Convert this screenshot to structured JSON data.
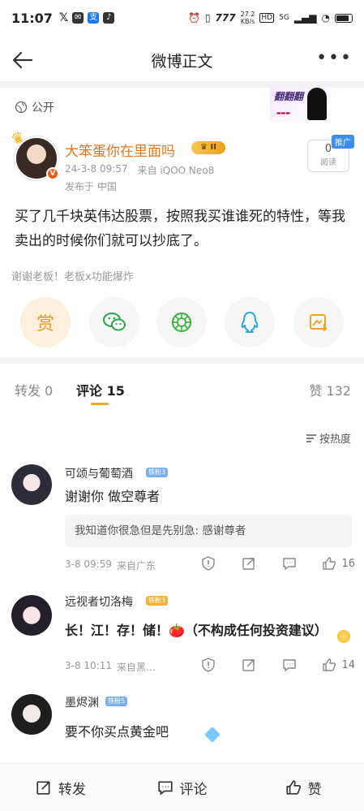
{
  "status_bar": {
    "time": "11:07",
    "net_speed": "27.2",
    "net_unit": "KB/s",
    "hd": "HD",
    "net_type": "5G"
  },
  "nav": {
    "title": "微博正文"
  },
  "post": {
    "visibility": "公开",
    "author_name": "大笨蛋你在里面吗",
    "level": "II",
    "date": "24-3-8 09:57",
    "source": "来自 iQOO Neo8",
    "location": "发布于 中国",
    "read_count": "0",
    "read_label": "阅读",
    "promo_label": "推广",
    "text": "买了几千块英伟达股票，按照我买谁谁死的特性，等我卖出的时候你们就可以抄底了。",
    "tagline": "谢谢老板！老板x功能爆炸",
    "reward_label": "赏"
  },
  "tabs": {
    "repost": "转发 0",
    "comment": "评论 15",
    "like": "赞 132"
  },
  "sort_label": "按热度",
  "comments": [
    {
      "name": "可颂与葡萄酒",
      "badge": "铁粉3",
      "text": "谢谢你 做空尊者",
      "reply": "我知道你很急但是先别急: 感谢尊者",
      "time": "3-8 09:59",
      "source": "来自广东",
      "likes": "16"
    },
    {
      "name": "远视者切洛梅",
      "badge": "铁粉3",
      "text": "长！江！存！储！🍅（不构成任何投资建议）",
      "time": "3-8 10:11",
      "source": "来自黑…",
      "likes": "14"
    },
    {
      "name": "墨烬渊",
      "badge": "铁粉5",
      "text": "要不你买点黄金吧"
    }
  ],
  "bottom_bar": {
    "repost": "转发",
    "comment": "评论",
    "like": "赞"
  },
  "colors": {
    "author_name": "#e4761c",
    "accent": "#f5a623",
    "wechat_green": "#2aa34a",
    "moments_green": "#46b44a",
    "qq_blue": "#2aa8e0"
  }
}
